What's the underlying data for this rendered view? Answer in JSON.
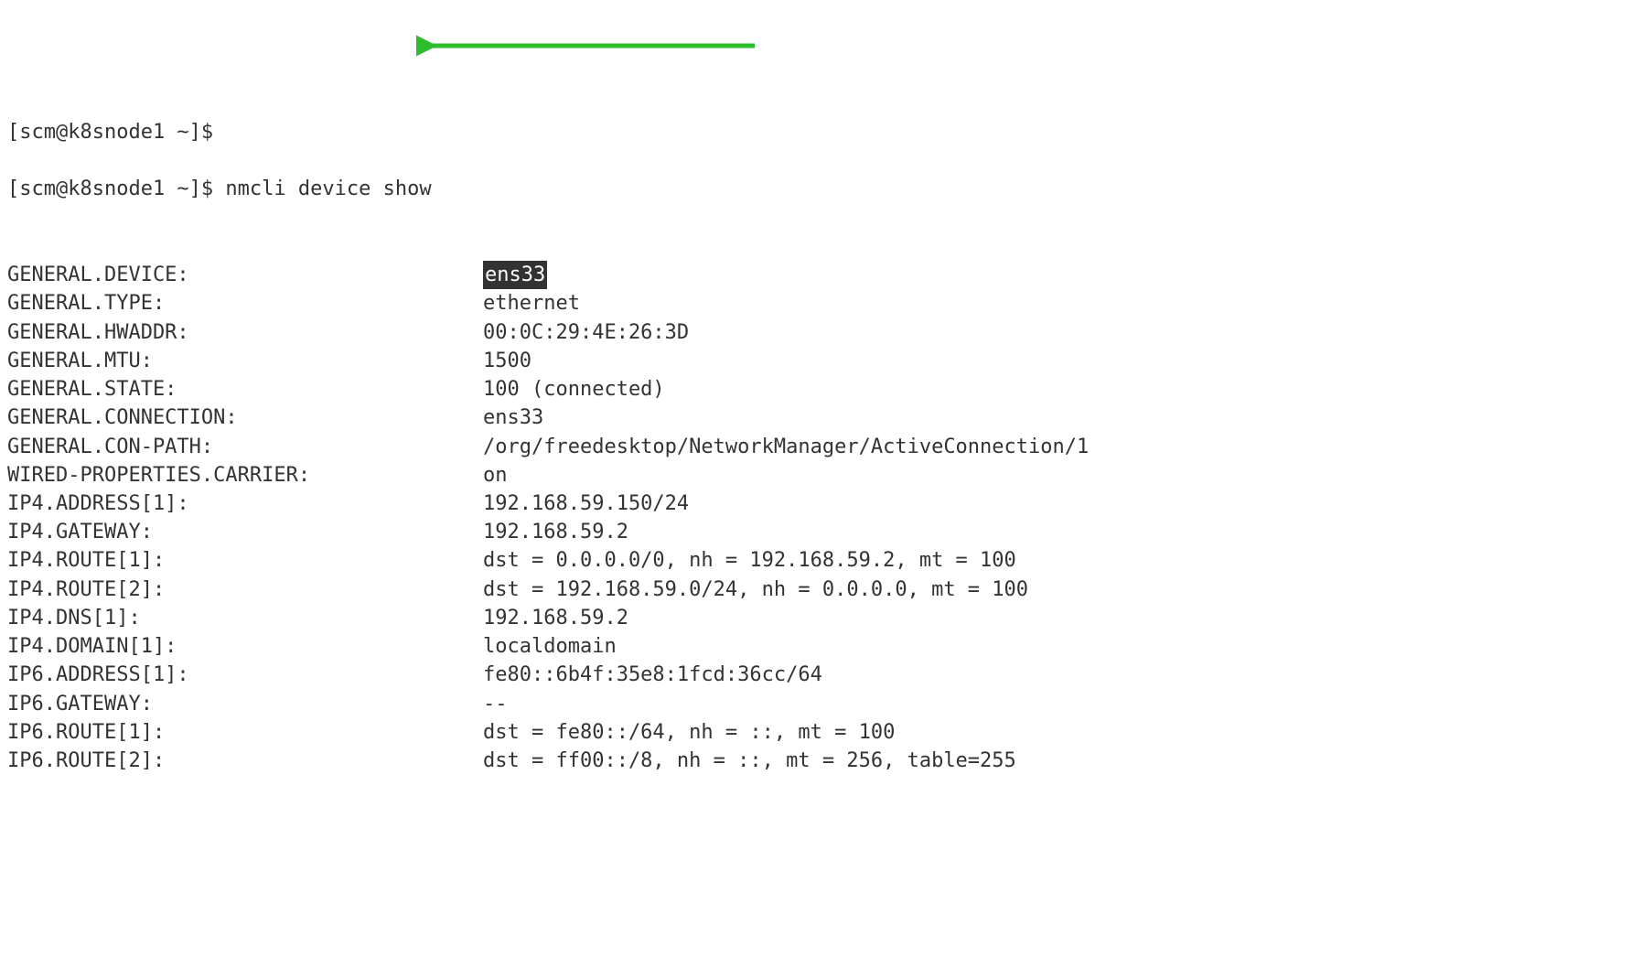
{
  "prompts": [
    "[scm@k8snode1 ~]$ ",
    "[scm@k8snode1 ~]$ "
  ],
  "command": "nmcli device show",
  "output": [
    {
      "key": "GENERAL.DEVICE:",
      "value": "ens33",
      "highlighted": true
    },
    {
      "key": "GENERAL.TYPE:",
      "value": "ethernet",
      "highlighted": false
    },
    {
      "key": "GENERAL.HWADDR:",
      "value": "00:0C:29:4E:26:3D",
      "highlighted": false
    },
    {
      "key": "GENERAL.MTU:",
      "value": "1500",
      "highlighted": false
    },
    {
      "key": "GENERAL.STATE:",
      "value": "100 (connected)",
      "highlighted": false
    },
    {
      "key": "GENERAL.CONNECTION:",
      "value": "ens33",
      "highlighted": false
    },
    {
      "key": "GENERAL.CON-PATH:",
      "value": "/org/freedesktop/NetworkManager/ActiveConnection/1",
      "highlighted": false
    },
    {
      "key": "WIRED-PROPERTIES.CARRIER:",
      "value": "on",
      "highlighted": false
    },
    {
      "key": "IP4.ADDRESS[1]:",
      "value": "192.168.59.150/24",
      "highlighted": false
    },
    {
      "key": "IP4.GATEWAY:",
      "value": "192.168.59.2",
      "highlighted": false
    },
    {
      "key": "IP4.ROUTE[1]:",
      "value": "dst = 0.0.0.0/0, nh = 192.168.59.2, mt = 100",
      "highlighted": false
    },
    {
      "key": "IP4.ROUTE[2]:",
      "value": "dst = 192.168.59.0/24, nh = 0.0.0.0, mt = 100",
      "highlighted": false
    },
    {
      "key": "IP4.DNS[1]:",
      "value": "192.168.59.2",
      "highlighted": false
    },
    {
      "key": "IP4.DOMAIN[1]:",
      "value": "localdomain",
      "highlighted": false
    },
    {
      "key": "IP6.ADDRESS[1]:",
      "value": "fe80::6b4f:35e8:1fcd:36cc/64",
      "highlighted": false
    },
    {
      "key": "IP6.GATEWAY:",
      "value": "--",
      "highlighted": false
    },
    {
      "key": "IP6.ROUTE[1]:",
      "value": "dst = fe80::/64, nh = ::, mt = 100",
      "highlighted": false
    },
    {
      "key": "IP6.ROUTE[2]:",
      "value": "dst = ff00::/8, nh = ::, mt = 256, table=255",
      "highlighted": false
    }
  ],
  "arrow": {
    "color": "#2dbd2d"
  }
}
